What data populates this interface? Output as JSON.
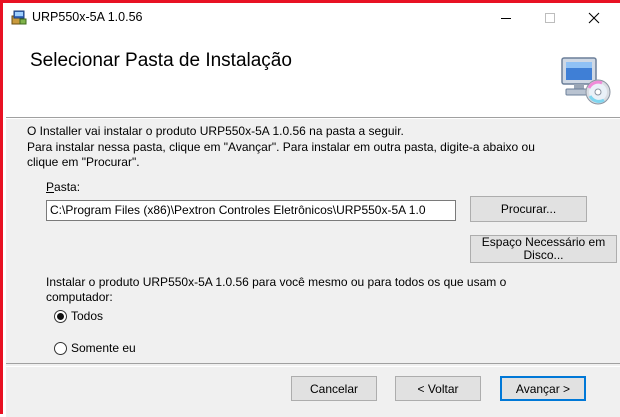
{
  "window": {
    "title": "URP550x-5A 1.0.56",
    "accent_border_color": "#e81123",
    "controls": {
      "minimize": "—",
      "maximize": "☐",
      "close": "✕"
    }
  },
  "header": {
    "title": "Selecionar Pasta de Instalação",
    "icon": "computer-disc-icon"
  },
  "body": {
    "line1": "O Installer vai instalar o produto URP550x-5A 1.0.56 na pasta a seguir.",
    "line2": "Para instalar nessa pasta, clique em \"Avançar\". Para instalar em outra pasta, digite-a abaixo ou",
    "line3": "clique em \"Procurar\".",
    "folder_label_first": "P",
    "folder_label_rest": "asta:",
    "folder_value": "C:\\Program Files (x86)\\Pextron Controles Eletrônicos\\URP550x-5A 1.0",
    "browse_button": "Procurar...",
    "disk_space_button_line1": "Espaço Necessário em",
    "disk_space_button_line2": "Disco...",
    "install_for_line1": "Instalar o produto URP550x-5A 1.0.56 para você mesmo ou para todos os que usam o",
    "install_for_line2": "computador:",
    "options": [
      {
        "label": "Todos",
        "selected": true
      },
      {
        "label": "Somente eu",
        "selected": false
      }
    ]
  },
  "footer": {
    "cancel": "Cancelar",
    "back": "< Voltar",
    "next": "Avançar >"
  }
}
